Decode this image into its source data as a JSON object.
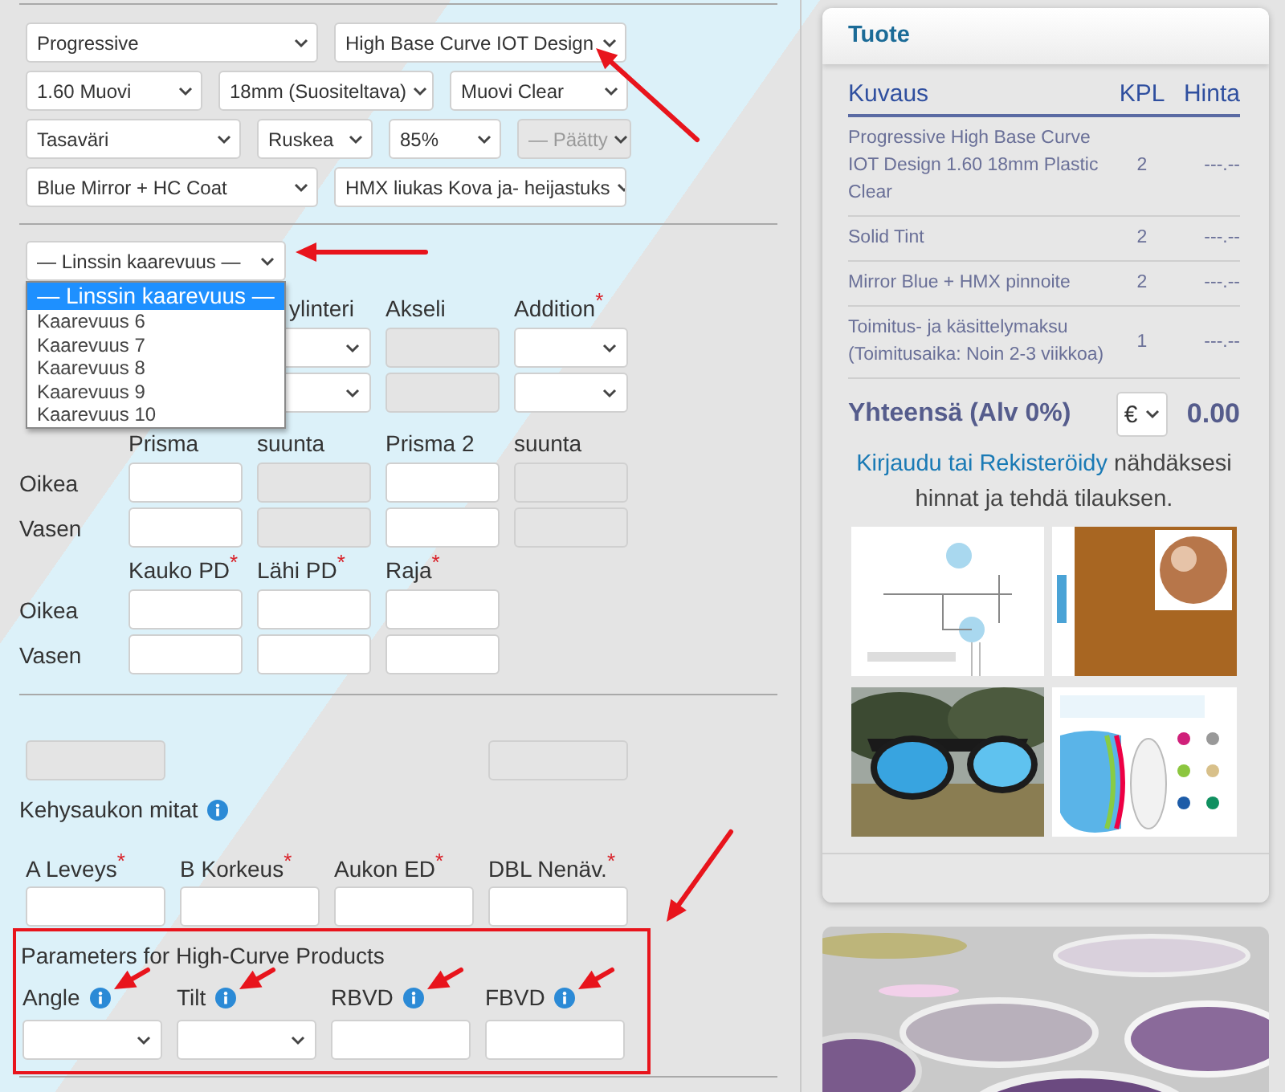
{
  "product": {
    "rows": [
      {
        "selects": [
          {
            "value": "Progressive",
            "disabled": false,
            "pointed": false
          },
          {
            "value": "High Base Curve IOT Design",
            "disabled": false,
            "pointed": true
          }
        ]
      },
      {
        "selects": [
          {
            "value": "1.60 Muovi",
            "disabled": false,
            "pointed": false
          },
          {
            "value": "18mm (Suositeltava)",
            "disabled": false,
            "pointed": false
          },
          {
            "value": "Muovi Clear",
            "disabled": false,
            "pointed": false
          }
        ]
      },
      {
        "selects": [
          {
            "value": "Tasaväri",
            "disabled": false,
            "pointed": false
          },
          {
            "value": "Ruskea",
            "disabled": false,
            "pointed": false
          },
          {
            "value": "85%",
            "disabled": false,
            "pointed": false
          },
          {
            "value": "— Päätty",
            "disabled": true,
            "pointed": false
          }
        ]
      },
      {
        "selects": [
          {
            "value": "Blue Mirror + HC Coat",
            "disabled": false,
            "pointed": false
          },
          {
            "value": "HMX liukas Kova ja- heijastuks",
            "disabled": false,
            "pointed": false
          }
        ]
      }
    ]
  },
  "curvature": {
    "value": "— Linssin kaarevuus —",
    "expanded": true,
    "pointed": true,
    "options": [
      {
        "label": "— Linssin kaarevuus —",
        "selected": true
      },
      {
        "label": "Kaarevuus 6",
        "selected": false
      },
      {
        "label": "Kaarevuus 7",
        "selected": false
      },
      {
        "label": "Kaarevuus 8",
        "selected": false
      },
      {
        "label": "Kaarevuus 9",
        "selected": false
      },
      {
        "label": "Kaarevuus 10",
        "selected": false
      }
    ]
  },
  "prescription": {
    "blocks": [
      {
        "headers": [
          {
            "kind": "covered"
          },
          {
            "kind": "partly-covered",
            "label": "ylinteri"
          },
          {
            "kind": "text",
            "label": "Akseli"
          },
          {
            "kind": "text",
            "label": "Addition",
            "mark": "*"
          }
        ],
        "rows": [
          {
            "cells": [
              {
                "kind": "covered"
              },
              {
                "kind": "select"
              },
              {
                "kind": "disabled"
              },
              {
                "kind": "select"
              }
            ]
          },
          {
            "cells": [
              {
                "kind": "covered"
              },
              {
                "kind": "select"
              },
              {
                "kind": "disabled"
              },
              {
                "kind": "select"
              }
            ]
          }
        ]
      },
      {
        "headers": [
          {
            "kind": "text",
            "label": "Prisma"
          },
          {
            "kind": "text",
            "label": "suunta"
          },
          {
            "kind": "text",
            "label": "Prisma 2"
          },
          {
            "kind": "text",
            "label": "suunta"
          }
        ],
        "rows": [
          {
            "label": "Oikea",
            "cells": [
              {
                "kind": "input"
              },
              {
                "kind": "disabled"
              },
              {
                "kind": "input"
              },
              {
                "kind": "disabled"
              }
            ]
          },
          {
            "label": "Vasen",
            "cells": [
              {
                "kind": "input"
              },
              {
                "kind": "disabled"
              },
              {
                "kind": "input"
              },
              {
                "kind": "disabled"
              }
            ]
          }
        ]
      },
      {
        "headers": [
          {
            "kind": "text",
            "label": "Kauko PD",
            "mark": "*"
          },
          {
            "kind": "text",
            "label": "Lähi PD",
            "mark": "*"
          },
          {
            "kind": "text",
            "label": "Raja",
            "mark": "*"
          }
        ],
        "rows": [
          {
            "label": "Oikea",
            "cells": [
              {
                "kind": "input"
              },
              {
                "kind": "input"
              },
              {
                "kind": "input"
              }
            ]
          },
          {
            "label": "Vasen",
            "cells": [
              {
                "kind": "input"
              },
              {
                "kind": "input"
              },
              {
                "kind": "input"
              }
            ]
          }
        ]
      }
    ]
  },
  "blank_fields": [
    {
      "kind": "disabled"
    },
    {
      "kind": "empty"
    },
    {
      "kind": "empty"
    },
    {
      "kind": "disabled"
    }
  ],
  "frame": {
    "title": "Kehysaukon mitat",
    "info": true,
    "fields": [
      {
        "label": "A Leveys",
        "mark": "*",
        "kind": "input"
      },
      {
        "label": "B Korkeus",
        "mark": "*",
        "kind": "input"
      },
      {
        "label": "Aukon ED",
        "mark": "*",
        "kind": "input"
      },
      {
        "label": "DBL Nenäv.",
        "mark": "*",
        "kind": "input"
      }
    ]
  },
  "high_curve": {
    "title": "Parameters for High-Curve Products",
    "highlighted": true,
    "pointed": true,
    "fields": [
      {
        "label": "Angle",
        "info": true,
        "pointed": true,
        "kind": "select"
      },
      {
        "label": "Tilt",
        "info": true,
        "pointed": true,
        "kind": "select"
      },
      {
        "label": "RBVD",
        "info": true,
        "pointed": true,
        "kind": "input"
      },
      {
        "label": "FBVD",
        "info": true,
        "pointed": true,
        "kind": "input"
      }
    ]
  },
  "cart": {
    "title": "Tuote",
    "columns": [
      "Kuvaus",
      "KPL",
      "Hinta"
    ],
    "rows": [
      {
        "description": "Progressive High Base Curve IOT Design 1.60 18mm Plastic Clear",
        "qty": "2",
        "price": "---.--"
      },
      {
        "description": "Solid Tint",
        "qty": "2",
        "price": "---.--"
      },
      {
        "description": "Mirror Blue + HMX pinnoite",
        "qty": "2",
        "price": "---.--"
      },
      {
        "description": "Toimitus- ja käsittelymaksu (Toimitusaika: Noin 2-3 viikkoa)",
        "qty": "1",
        "price": "---.--"
      }
    ],
    "total": {
      "label": "Yhteensä (Alv 0%)",
      "currency": "€",
      "amount": "0.00"
    },
    "login": {
      "link": "Kirjaudu tai Rekisteröidy",
      "text": "nähdäksesi hinnat ja tehdä tilauksen."
    },
    "images": [
      {
        "kind": "diagram"
      },
      {
        "kind": "swatch"
      },
      {
        "kind": "sunglasses"
      },
      {
        "kind": "coating"
      }
    ]
  }
}
